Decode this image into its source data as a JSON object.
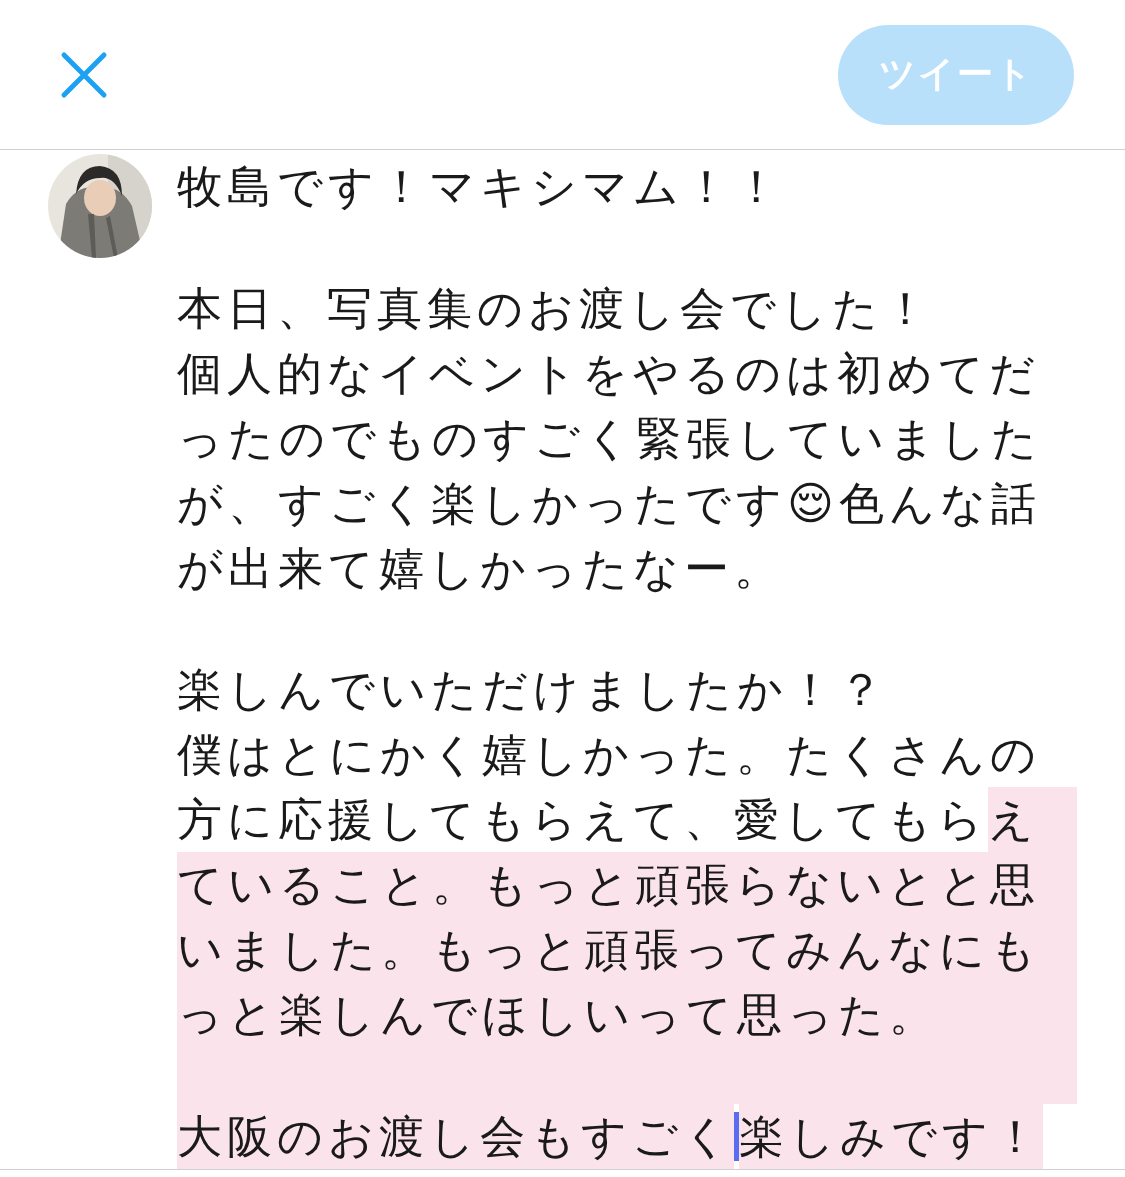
{
  "header": {
    "tweet_button": "ツイート",
    "tweet_enabled": false
  },
  "lines": [
    {
      "segments": [
        {
          "kind": "text",
          "text": "牧島です！マキシマム！！",
          "selected": false
        }
      ],
      "selected_to_end": false
    },
    {
      "selected_to_end": false
    },
    {
      "segments": [
        {
          "kind": "text",
          "text": "本日、写真集のお渡し会でした！",
          "selected": false
        }
      ],
      "selected_to_end": false
    },
    {
      "segments": [
        {
          "kind": "text",
          "text": "個人的なイベントをやるのは初めてだ",
          "selected": false
        }
      ],
      "selected_to_end": false
    },
    {
      "segments": [
        {
          "kind": "text",
          "text": "ったのでものすごく緊張していました",
          "selected": false
        }
      ],
      "selected_to_end": false
    },
    {
      "segments": [
        {
          "kind": "text",
          "text": "が、すごく楽しかったです😌色んな話",
          "selected": false
        }
      ],
      "selected_to_end": false
    },
    {
      "segments": [
        {
          "kind": "text",
          "text": "が出来て嬉しかったなー。",
          "selected": false
        }
      ],
      "selected_to_end": false
    },
    {
      "selected_to_end": false
    },
    {
      "segments": [
        {
          "kind": "text",
          "text": "楽しんでいただけましたか！？",
          "selected": false
        }
      ],
      "selected_to_end": false
    },
    {
      "segments": [
        {
          "kind": "text",
          "text": "僕はとにかく嬉しかった。たくさんの",
          "selected": false
        }
      ],
      "selected_to_end": false
    },
    {
      "segments": [
        {
          "kind": "text",
          "text": "方に応援してもらえて、愛してもら",
          "selected": false
        },
        {
          "kind": "text",
          "text": "え",
          "selected": true
        }
      ],
      "selected_to_end": true
    },
    {
      "segments": [
        {
          "kind": "text",
          "text": "ていること。もっと頑張らないとと思",
          "selected": true
        }
      ],
      "selected_to_end": true
    },
    {
      "segments": [
        {
          "kind": "text",
          "text": "いました。もっと頑張ってみんなにも",
          "selected": true
        }
      ],
      "selected_to_end": true
    },
    {
      "segments": [
        {
          "kind": "text",
          "text": "っと楽しんでほしいって思った。",
          "selected": true
        }
      ],
      "selected_to_end": true
    },
    {
      "selected_to_end": true
    },
    {
      "segments": [
        {
          "kind": "text",
          "text": "大阪のお渡し会もすごく",
          "selected": true
        },
        {
          "kind": "caret"
        },
        {
          "kind": "text",
          "text": "楽しみです！",
          "selected": true
        }
      ],
      "selected_to_end": false
    }
  ]
}
